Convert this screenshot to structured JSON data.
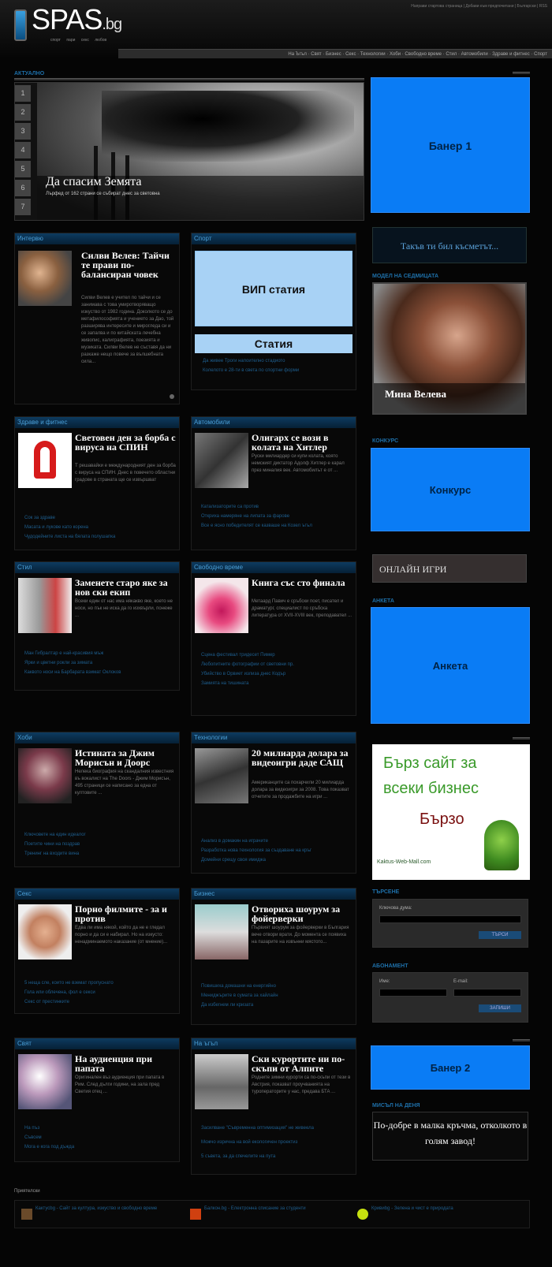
{
  "header": {
    "logo": "SPAS",
    "logo_suffix": ".bg",
    "tagline": "спорт  пари  секс  любов",
    "toplinks": "Направи стартова страница | Добави към предпочитани | Български | RSS"
  },
  "nav": {
    "items": [
      "На Ъгъл",
      "Свят",
      "Бизнес",
      "Секс",
      "Технологии",
      "Хоби",
      "Свободно време",
      "Стил",
      "Автомобили",
      "Здраве и фитнес",
      "Спорт"
    ]
  },
  "section_current": "АКТУАЛНО",
  "slider": {
    "numbers": [
      "1",
      "2",
      "3",
      "4",
      "5",
      "6",
      "7"
    ],
    "title": "Да спасим Земята",
    "desc": "Лърфед от 162 страни се събират днес за световна"
  },
  "banners": {
    "b1": "Банер 1",
    "karma": "Такъв ти бил късметът...",
    "konkurs": "Конкурс",
    "games": "ОНЛАЙН ИГРИ",
    "anketa": "Анкета",
    "b2": "Банер 2"
  },
  "right": {
    "model_title": "МОДЕЛ НА СЕДМИЦАТА",
    "model_name": "Мина Велева",
    "konkurs_title": "КОНКУРС",
    "anketa_title": "АНКЕТА",
    "search_title": "ТЪРСЕНЕ",
    "search_label": "Ключова дума:",
    "search_btn": "ТЪРСИ",
    "sub_title": "АБОНАМЕНТ",
    "sub_name": "Име:",
    "sub_email": "E-mail:",
    "sub_btn": "ЗАПИШИ",
    "thought_title": "МИСЪЛ НА ДЕНЯ",
    "thought": "По-добре в малка кръчма, отколкото в голям завод!",
    "ad_line1": "Бърз сайт за",
    "ad_line2": "всеки бизнес",
    "ad_line3": "Бързо",
    "ad_url": "Kaktus-Web-Mall.com"
  },
  "vip": {
    "big": "ВИП статия",
    "small": "Статия"
  },
  "boxes": [
    {
      "head": "Интервю",
      "title": "Силви Велев: Тайчи те прави по-балансиран човек",
      "text": "Силви Велев е учител по тайчи и се занимава с това умиротворяващо изкуство от 1982 година. Доколкото се до метафилософията и учението за Дао, той разширява интересите и мирогледа си и се запалва и по китайската лечебна живопис, калиграфията, поезията и музиката. Силви Велев не съставя да ни разкаже нещо повече за вълшебната сила...",
      "links": []
    },
    {
      "head": "Спорт",
      "title": "",
      "text": "",
      "links": [
        "Да живее Троги напоително стадиото",
        "Колелото е 28-ти в света по спортни форми"
      ]
    },
    {
      "head": "Здраве и фитнес",
      "title": "Световен ден за борба с вируса на СПИН",
      "text": "Т решавайки е международният ден за борба с вируса на СПИН. Днес в повечето областни градове в страната ще се извършват",
      "links": [
        "Сок за здраве",
        "Масата и лукове като корена",
        "Чудодейните листа на бялата полушапка"
      ]
    },
    {
      "head": "Автомобили",
      "title": "Олигарх се вози в колата на Хитлер",
      "text": "Руски милиардер си купи колата, която немският диктатор Адолф Хитлер е карал през миналия век. Автомобилът е от ...",
      "links": [
        "Катализаторите са против",
        "Откриха намеряне на липата за фарове",
        "Все е ясно победителят се казваше на Козел ъгъл"
      ]
    },
    {
      "head": "Стил",
      "title": "Заменете старо яке за нов ски екип",
      "text": "Всеки един от нас има някакво яке, което не носи, но пък не иска да го изхвърли, понеже ...",
      "links": [
        "Ман Гибралтар е най-красивия мъж",
        "Ярки и цветни рокли за зимата",
        "Каквото носи на Барбарата взимат Оклоков"
      ]
    },
    {
      "head": "Свободно време",
      "title": "Книга със сто финала",
      "text": "Метаард Павич е сръбски поет, писател и драматург, специалист по сръбска литература от XVII-XVIII век, преподавател ...",
      "links": [
        "Сцена фестивал тридесет Пимер",
        "Любопитните фотографии от световни пр.",
        "Убийство в Орвиет излиза днес Кодър",
        "Замията на тишината"
      ]
    },
    {
      "head": "Хоби",
      "title": "Истината за Джим Морисън и Доорс",
      "text": "Нелека биография на скандалния известния въ вокалист на The Doors - Джим Морисън, 495 страници се написано за една от култовите ...",
      "links": [
        "Ключовете на един идеалог",
        "Поетите чини на поздрав",
        "Тренинг на входите вина"
      ]
    },
    {
      "head": "Технологии",
      "title": "20 милиарда долара за видеоигри даде САЩ",
      "text": "Американците са похарчили 20 милиарда долара за видеоигри за 2008. Това показват отчетите за продажбите на игри ...",
      "links": [
        "Анализ в домакин на играчите",
        "Разработка нова технология за създаване на кръг",
        "Домейни срещу своя имиджа"
      ]
    },
    {
      "head": "Секс",
      "title": "Порно филмите - за и против",
      "text": "Едва ли има някой, който да не е гледал порно и да си е набирал. Но на изкусто: ненадминаемото наказание (от мнение)...",
      "links": [
        "5 неща сле, които не вземат пропуснато",
        "Гола или облечена, фол е секси",
        "Секс от престинките"
      ]
    },
    {
      "head": "Бизнес",
      "title": "Отвориха шоурум за фойерверки",
      "text": "Първият шоурум за фойерверки в България вече отвори врати. До момента се появиха на пазарите на извънни мястото...",
      "links": [
        "Повишиха домашни на енергийно",
        "Мениджърите в сумата за хайлайн",
        "Да избегнем ли кризата"
      ]
    },
    {
      "head": "Свят",
      "title": "На аудиенция при папата",
      "text": "Оригинален въз аудиенция при папата в Рим. След дълги години, на зала пред Светия отец ...",
      "links": [
        "На пъз",
        "Съвсем",
        "Мога е кога под дъжда"
      ]
    },
    {
      "head": "На ъгъл",
      "title": "Ски курортите ни по-скъпи от Алпите",
      "text": "Родните зимни курорти са по-скъпи от тези в Австрия, показват проучванията на туроператорите у нас, предава БТА ...",
      "links": [
        "Засилване \"Съвременна оптимизация\" не живеела",
        "Можчо изрична на вой екологичен проектиз",
        "5 съвета, за да спечелите на пута"
      ]
    }
  ],
  "footer": {
    "title": "Приятелски",
    "items": [
      "Кактусbg - Сайт за култура, изкуство и свободно време",
      "Балкон.bg - Електронна списание за студенти",
      "Кривиbg - Зелена и чист е природата"
    ]
  }
}
